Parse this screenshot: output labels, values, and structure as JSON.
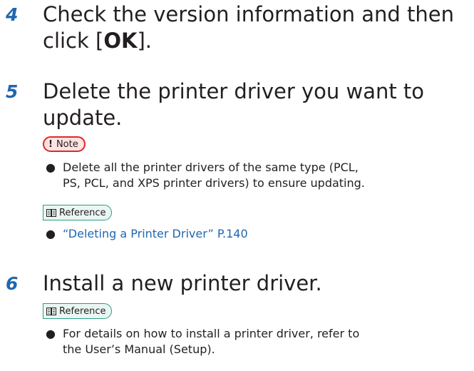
{
  "steps": [
    {
      "number": "4",
      "text_a": "Check the version information and then",
      "text_b_pre": "click [",
      "text_b_bold": "OK",
      "text_b_post": "]."
    },
    {
      "number": "5",
      "text_a": "Delete the printer driver you want to",
      "text_b": "update."
    },
    {
      "number": "6",
      "text_a": "Install a new printer driver."
    }
  ],
  "note": {
    "badge_label": "Note",
    "badge_symbol": "!",
    "item_line1": "Delete all the printer drivers of the same type (PCL,",
    "item_line2": "PS, PCL, and XPS printer drivers) to ensure updating."
  },
  "reference1": {
    "badge_label": "Reference",
    "link_text": "“Deleting a Printer Driver” P.140"
  },
  "reference2": {
    "badge_label": "Reference",
    "item_line1": "For details on how to install a printer driver, refer to",
    "item_line2": "the User’s Manual (Setup)."
  },
  "bullet_symbol": "●",
  "colors": {
    "step_number": "#1f67b0",
    "link": "#1f67b0",
    "note_border": "#e0262d",
    "reference_border": "#2e9d84"
  },
  "icons": {
    "reference": "book-icon"
  }
}
